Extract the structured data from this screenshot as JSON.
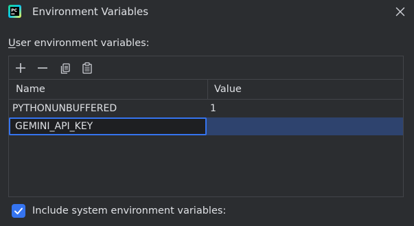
{
  "window": {
    "title": "Environment Variables",
    "app_icon_text": "PC"
  },
  "section": {
    "label_mnemonic": "U",
    "label_rest": "ser environment variables:"
  },
  "toolbar": {
    "buttons": [
      "plus-icon",
      "minus-icon",
      "copy-icon",
      "paste-icon"
    ]
  },
  "table": {
    "columns": [
      "Name",
      "Value"
    ],
    "rows": [
      {
        "name": "PYTHONUNBUFFERED",
        "value": "1"
      },
      {
        "name": "GEMINI_API_KEY",
        "value": ""
      }
    ]
  },
  "include_system": {
    "label": "Include system environment variables:",
    "checked": true
  },
  "colors": {
    "background": "#2b2d30",
    "accent": "#3574f0",
    "selection": "#2e436e",
    "border": "#43454a"
  }
}
